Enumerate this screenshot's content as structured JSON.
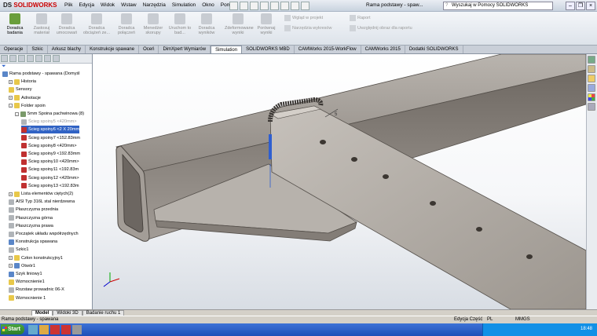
{
  "app": {
    "logo_brand": "DS",
    "logo_name": "SOLIDWORKS",
    "doc_title": "Rama podstawy - spaw...",
    "search_placeholder": "Wyszukaj w Pomocy SOLIDWORKS"
  },
  "menu": [
    "Plik",
    "Edycja",
    "Widok",
    "Wstaw",
    "Narzędzia",
    "Simulation",
    "Okno",
    "Pomoc"
  ],
  "ribbon": {
    "buttons": [
      {
        "label": "Doradca badania",
        "enabled": true
      },
      {
        "label": "Zastosuj materiał",
        "enabled": false
      },
      {
        "label": "Doradca umocowań",
        "enabled": false
      },
      {
        "label": "Doradca obciążeń ze...",
        "enabled": false
      },
      {
        "label": "Doradca połączeń",
        "enabled": false
      },
      {
        "label": "Menedżer skorupy",
        "enabled": false
      },
      {
        "label": "Uruchom to bad...",
        "enabled": false
      },
      {
        "label": "Doradca wyników",
        "enabled": false
      },
      {
        "label": "Zdeformowane wyniki",
        "enabled": false
      },
      {
        "label": "Porównaj wyniki",
        "enabled": false
      }
    ],
    "small": [
      "Wgląd w projekt",
      "Narzędzia wykresów",
      "Raport",
      "Uwzględnij obraz dla raportu"
    ]
  },
  "cm_tabs": [
    "Operacje",
    "Szkic",
    "Arkusz blachy",
    "Konstrukcje spawane",
    "Oceń",
    "DimXpert Wymiarów",
    "Simulation",
    "SOLIDWORKS MBD",
    "CAMWorks 2015-WorkFlow",
    "CAMWorks 2015",
    "Dodatki SOLIDWORKS"
  ],
  "cm_active": "Simulation",
  "tree": [
    {
      "label": "Rama podstawy - spawana  (Domyśl",
      "level": 0,
      "icon": "part-icon",
      "color": "b"
    },
    {
      "label": "Historia",
      "level": 1,
      "icon": "history-icon",
      "color": "y",
      "exp": "+"
    },
    {
      "label": "Sensory",
      "level": 1,
      "icon": "sensor-icon",
      "color": "y"
    },
    {
      "label": "Adnotacje",
      "level": 1,
      "icon": "annotation-icon",
      "color": "y",
      "exp": "+"
    },
    {
      "label": "Folder spoin",
      "level": 1,
      "icon": "folder-icon",
      "color": "y",
      "exp": "-"
    },
    {
      "label": "5mm Spoina pachwinowa (8)",
      "level": 2,
      "icon": "weld-icon",
      "color": "g",
      "exp": "-"
    },
    {
      "label": "Ścieg spoiny5 <420mm>",
      "level": 3,
      "icon": "bead-icon",
      "color": "gr",
      "dim": true
    },
    {
      "label": "Ścieg spoiny6 <2 X 20mm",
      "level": 3,
      "icon": "bead-icon",
      "color": "r",
      "sel": true
    },
    {
      "label": "Ścieg spoiny7 <152.83mm",
      "level": 3,
      "icon": "bead-icon",
      "color": "r"
    },
    {
      "label": "Ścieg spoiny8 <420mm>",
      "level": 3,
      "icon": "bead-icon",
      "color": "r"
    },
    {
      "label": "Ścieg spoiny9 <192.83mm",
      "level": 3,
      "icon": "bead-icon",
      "color": "r"
    },
    {
      "label": "Ścieg spoiny10 <420mm>",
      "level": 3,
      "icon": "bead-icon",
      "color": "r"
    },
    {
      "label": "Ścieg spoiny11 <192.83m",
      "level": 3,
      "icon": "bead-icon",
      "color": "r"
    },
    {
      "label": "Ścieg spoiny12 <420mm>",
      "level": 3,
      "icon": "bead-icon",
      "color": "r"
    },
    {
      "label": "Ścieg spoiny13 <192.83m",
      "level": 3,
      "icon": "bead-icon",
      "color": "r"
    },
    {
      "label": "Lista elementów ciętych(2)",
      "level": 1,
      "icon": "cutlist-icon",
      "color": "y",
      "exp": "+"
    },
    {
      "label": "AISI Typ 316L stal nierdzewna",
      "level": 1,
      "icon": "material-icon",
      "color": "gr"
    },
    {
      "label": "Płaszczyzna przednia",
      "level": 1,
      "icon": "plane-icon",
      "color": "gr"
    },
    {
      "label": "Płaszczyzna górna",
      "level": 1,
      "icon": "plane-icon",
      "color": "gr"
    },
    {
      "label": "Płaszczyzna prawa",
      "level": 1,
      "icon": "plane-icon",
      "color": "gr"
    },
    {
      "label": "Początek układu współrzędnych",
      "level": 1,
      "icon": "origin-icon",
      "color": "gr"
    },
    {
      "label": "Konstrukcja spawana",
      "level": 1,
      "icon": "weldment-icon",
      "color": "b"
    },
    {
      "label": "Szkic1",
      "level": 1,
      "icon": "sketch-icon",
      "color": "gr"
    },
    {
      "label": "Człon konstrukcyjny1",
      "level": 1,
      "icon": "member-icon",
      "color": "y",
      "exp": "+"
    },
    {
      "label": "Otwór1",
      "level": 1,
      "icon": "hole-icon",
      "color": "b",
      "exp": "+"
    },
    {
      "label": "Szyk liniowy1",
      "level": 1,
      "icon": "pattern-icon",
      "color": "b"
    },
    {
      "label": "Wzmocnienie1",
      "level": 1,
      "icon": "gusset-icon",
      "color": "y"
    },
    {
      "label": "Rozstaw prowadnic 06-X",
      "level": 1,
      "icon": "sketch-icon",
      "color": "gr"
    },
    {
      "label": "Wzmocnienie 1",
      "level": 1,
      "icon": "gusset-icon",
      "color": "y"
    }
  ],
  "model_tabs": [
    "Model",
    "Widoki 3D",
    "Badanie ruchu 1"
  ],
  "status": {
    "left": "Rama podstawy - spawana",
    "edit": "Edycja Część",
    "lang": "PL",
    "units": "MMGS"
  },
  "tray_time": "18:48",
  "colors": {
    "selection": "#3163c4",
    "weld": "#c03030",
    "ribbon_on": "#6a9e3c"
  }
}
